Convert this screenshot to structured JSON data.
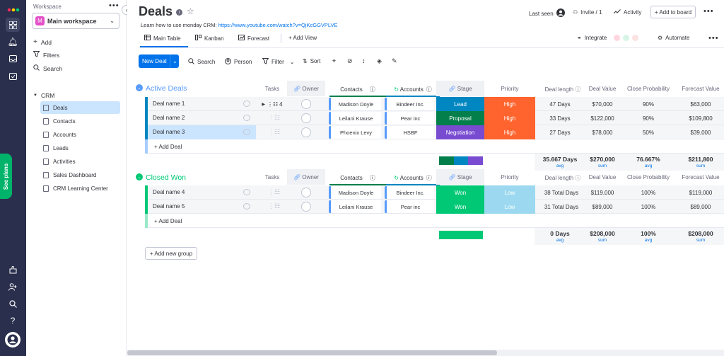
{
  "rail": {
    "see_plans": "See plans"
  },
  "sidebar": {
    "workspace_label": "Workspace",
    "workspace_name": "Main workspace",
    "workspace_avatar": "M",
    "actions": [
      "Add",
      "Filters",
      "Search"
    ],
    "folder": "CRM",
    "items": [
      "Deals",
      "Contacts",
      "Accounts",
      "Leads",
      "Activities",
      "Sales Dashboard",
      "CRM Learning Center"
    ]
  },
  "header": {
    "title": "Deals",
    "learn_text": "Learn how to use monday CRM:",
    "learn_link": "https://www.youtube.com/watch?v=QjKcGGVPLVE",
    "last_seen": "Last seen",
    "invite": "Invite / 1",
    "activity": "Activity",
    "add_to_board": "+ Add to board"
  },
  "views": {
    "tabs": [
      "Main Table",
      "Kanban",
      "Forecast"
    ],
    "add_view": "+ Add View",
    "integrate": "Integrate",
    "automate": "Automate"
  },
  "toolbar": {
    "new_deal": "New Deal",
    "search": "Search",
    "person": "Person",
    "filter": "Filter",
    "sort": "Sort"
  },
  "columns": {
    "tasks": "Tasks",
    "owner": "Owner",
    "contacts": "Contacts",
    "accounts": "Accounts",
    "stage": "Stage",
    "priority": "Priority",
    "deal_length": "Deal length",
    "deal_value": "Deal Value",
    "close_prob": "Close Probability",
    "forecast": "Forecast Value"
  },
  "groups": [
    {
      "name": "Active Deals",
      "color": "#579bfc",
      "add_label": "+ Add Deal",
      "rows": [
        {
          "name": "Deal name 1",
          "tasks": "4",
          "contact": "Madison Doyle",
          "account": "Bindeer Inc.",
          "stage": "Lead",
          "stage_color": "#0086c0",
          "priority": "High",
          "priority_color": "#ff642e",
          "length": "47 Days",
          "value": "$70,000",
          "prob": "90%",
          "forecast": "$63,000"
        },
        {
          "name": "Deal name 2",
          "tasks": "",
          "contact": "Leilani Krause",
          "account": "Pear inc",
          "stage": "Proposal",
          "stage_color": "#037f4c",
          "priority": "High",
          "priority_color": "#ff642e",
          "length": "33 Days",
          "value": "$122,000",
          "prob": "90%",
          "forecast": "$109,800"
        },
        {
          "name": "Deal name 3",
          "tasks": "",
          "contact": "Phoenix Levy",
          "account": "HSBF",
          "stage": "Negotiation",
          "stage_color": "#784bd1",
          "priority": "High",
          "priority_color": "#ff642e",
          "length": "27 Days",
          "value": "$78,000",
          "prob": "50%",
          "forecast": "$39,000"
        }
      ],
      "summary": {
        "length": "35.667 Days",
        "length_fn": "avg",
        "value": "$270,000",
        "value_fn": "sum",
        "prob": "76.667%",
        "prob_fn": "avg",
        "forecast": "$211,800",
        "forecast_fn": "sum"
      }
    },
    {
      "name": "Closed Won",
      "color": "#00c875",
      "add_label": "+ Add Deal",
      "rows": [
        {
          "name": "Deal name 4",
          "tasks": "",
          "contact": "Madison Doyle",
          "account": "Bindeer Inc.",
          "stage": "Won",
          "stage_color": "#00c875",
          "priority": "Low",
          "priority_color": "#9cd9f0",
          "length": "38 Total Days",
          "value": "$119,000",
          "prob": "100%",
          "forecast": "$119,000"
        },
        {
          "name": "Deal name 5",
          "tasks": "",
          "contact": "Leilani Krause",
          "account": "Pear inc",
          "stage": "Won",
          "stage_color": "#00c875",
          "priority": "Low",
          "priority_color": "#9cd9f0",
          "length": "31 Total Days",
          "value": "$89,000",
          "prob": "100%",
          "forecast": "$89,000"
        }
      ],
      "summary": {
        "length": "0 Days",
        "length_fn": "avg",
        "value": "$208,000",
        "value_fn": "sum",
        "prob": "100%",
        "prob_fn": "avg",
        "forecast": "$208,000",
        "forecast_fn": "sum"
      }
    }
  ],
  "add_group": "+ Add new group"
}
